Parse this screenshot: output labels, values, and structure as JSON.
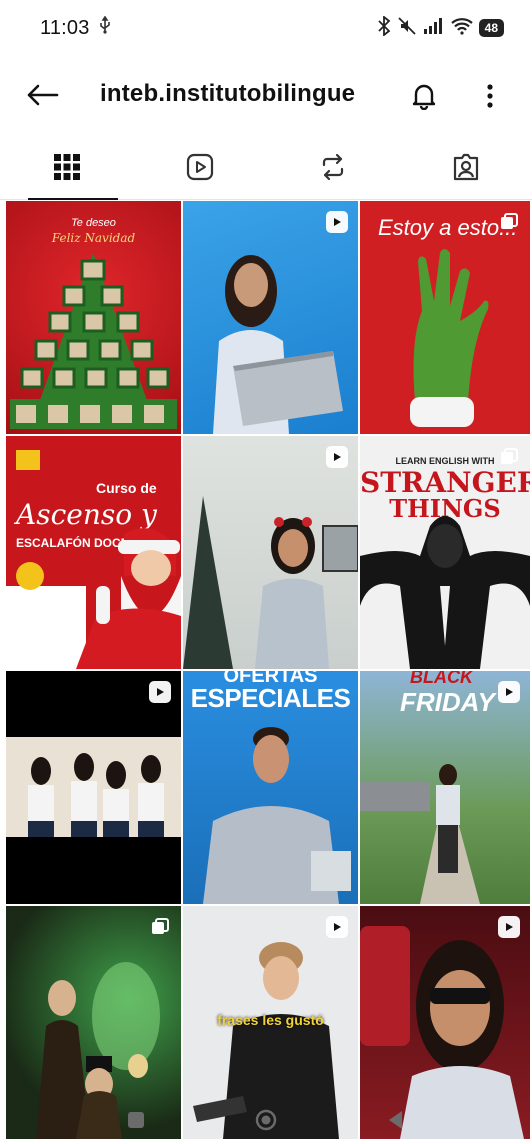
{
  "status": {
    "time": "11:03",
    "battery": "48"
  },
  "header": {
    "username": "inteb.institutobilingue"
  },
  "tabs": [
    {
      "name": "grid",
      "icon": "grid-icon"
    },
    {
      "name": "reels",
      "icon": "reels-icon"
    },
    {
      "name": "reposts",
      "icon": "repost-icon"
    },
    {
      "name": "tagged",
      "icon": "tagged-icon"
    }
  ],
  "posts": [
    {
      "type": "post",
      "text_top": "Te deseo",
      "text_main": "Feliz Navidad"
    },
    {
      "type": "reel"
    },
    {
      "type": "post",
      "text_main": "Estoy a esto..."
    },
    {
      "type": "post",
      "text_top": "Curso de",
      "text_main": "Ascenso y",
      "text_sub": "ESCALAFÓN DOCENTE"
    },
    {
      "type": "reel"
    },
    {
      "type": "post",
      "text_top": "LEARN ENGLISH WITH",
      "text_main": "STRANGER",
      "text_sub": "THINGS"
    },
    {
      "type": "reel"
    },
    {
      "type": "reel",
      "text_main": "ESPECIALES",
      "text_top": "OFERTAS"
    },
    {
      "type": "reel",
      "text_top": "BLACK",
      "text_main": "FRIDAY"
    },
    {
      "type": "post"
    },
    {
      "type": "reel",
      "caption": "frases les gustó"
    },
    {
      "type": "reel"
    }
  ],
  "colors": {
    "accent": "#111111",
    "red_bg": "#c4161c",
    "blue_bg": "#1f8fd6"
  }
}
